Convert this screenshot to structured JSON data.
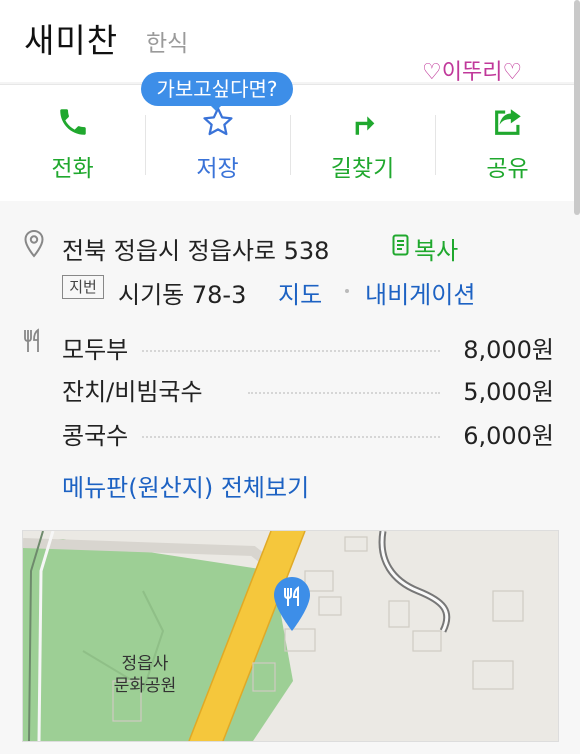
{
  "header": {
    "place_name": "새미찬",
    "category": "한식",
    "watermark": "♡이뚜리♡"
  },
  "actions": {
    "call_label": "전화",
    "save_label": "저장",
    "directions_label": "길찾기",
    "share_label": "공유",
    "save_tooltip": "가보고싶다면?"
  },
  "address": {
    "road": "전북 정읍시 정읍사로 538",
    "copy_label": "복사",
    "jibun_tag": "지번",
    "jibun": "시기동 78-3",
    "map_link": "지도",
    "navigation_link": "내비게이션"
  },
  "menu": {
    "items": [
      {
        "name": "모두부",
        "price": "8,000원"
      },
      {
        "name": "잔치/비빔국수",
        "price": "5,000원"
      },
      {
        "name": "콩국수",
        "price": "6,000원"
      }
    ],
    "view_all_label": "메뉴판(원산지) 전체보기"
  },
  "map": {
    "park_label_line1": "정읍사",
    "park_label_line2": "문화공원"
  },
  "colors": {
    "accent_green": "#20a82e",
    "link_blue": "#1d62c3",
    "tooltip_blue": "#3d8ee8",
    "road_yellow": "#f5c73c",
    "park_green": "#9dcf95"
  },
  "icons": [
    "phone-icon",
    "star-icon",
    "directions-icon",
    "share-icon",
    "location-pin-icon",
    "copy-icon",
    "restaurant-icon",
    "map-marker-icon"
  ]
}
